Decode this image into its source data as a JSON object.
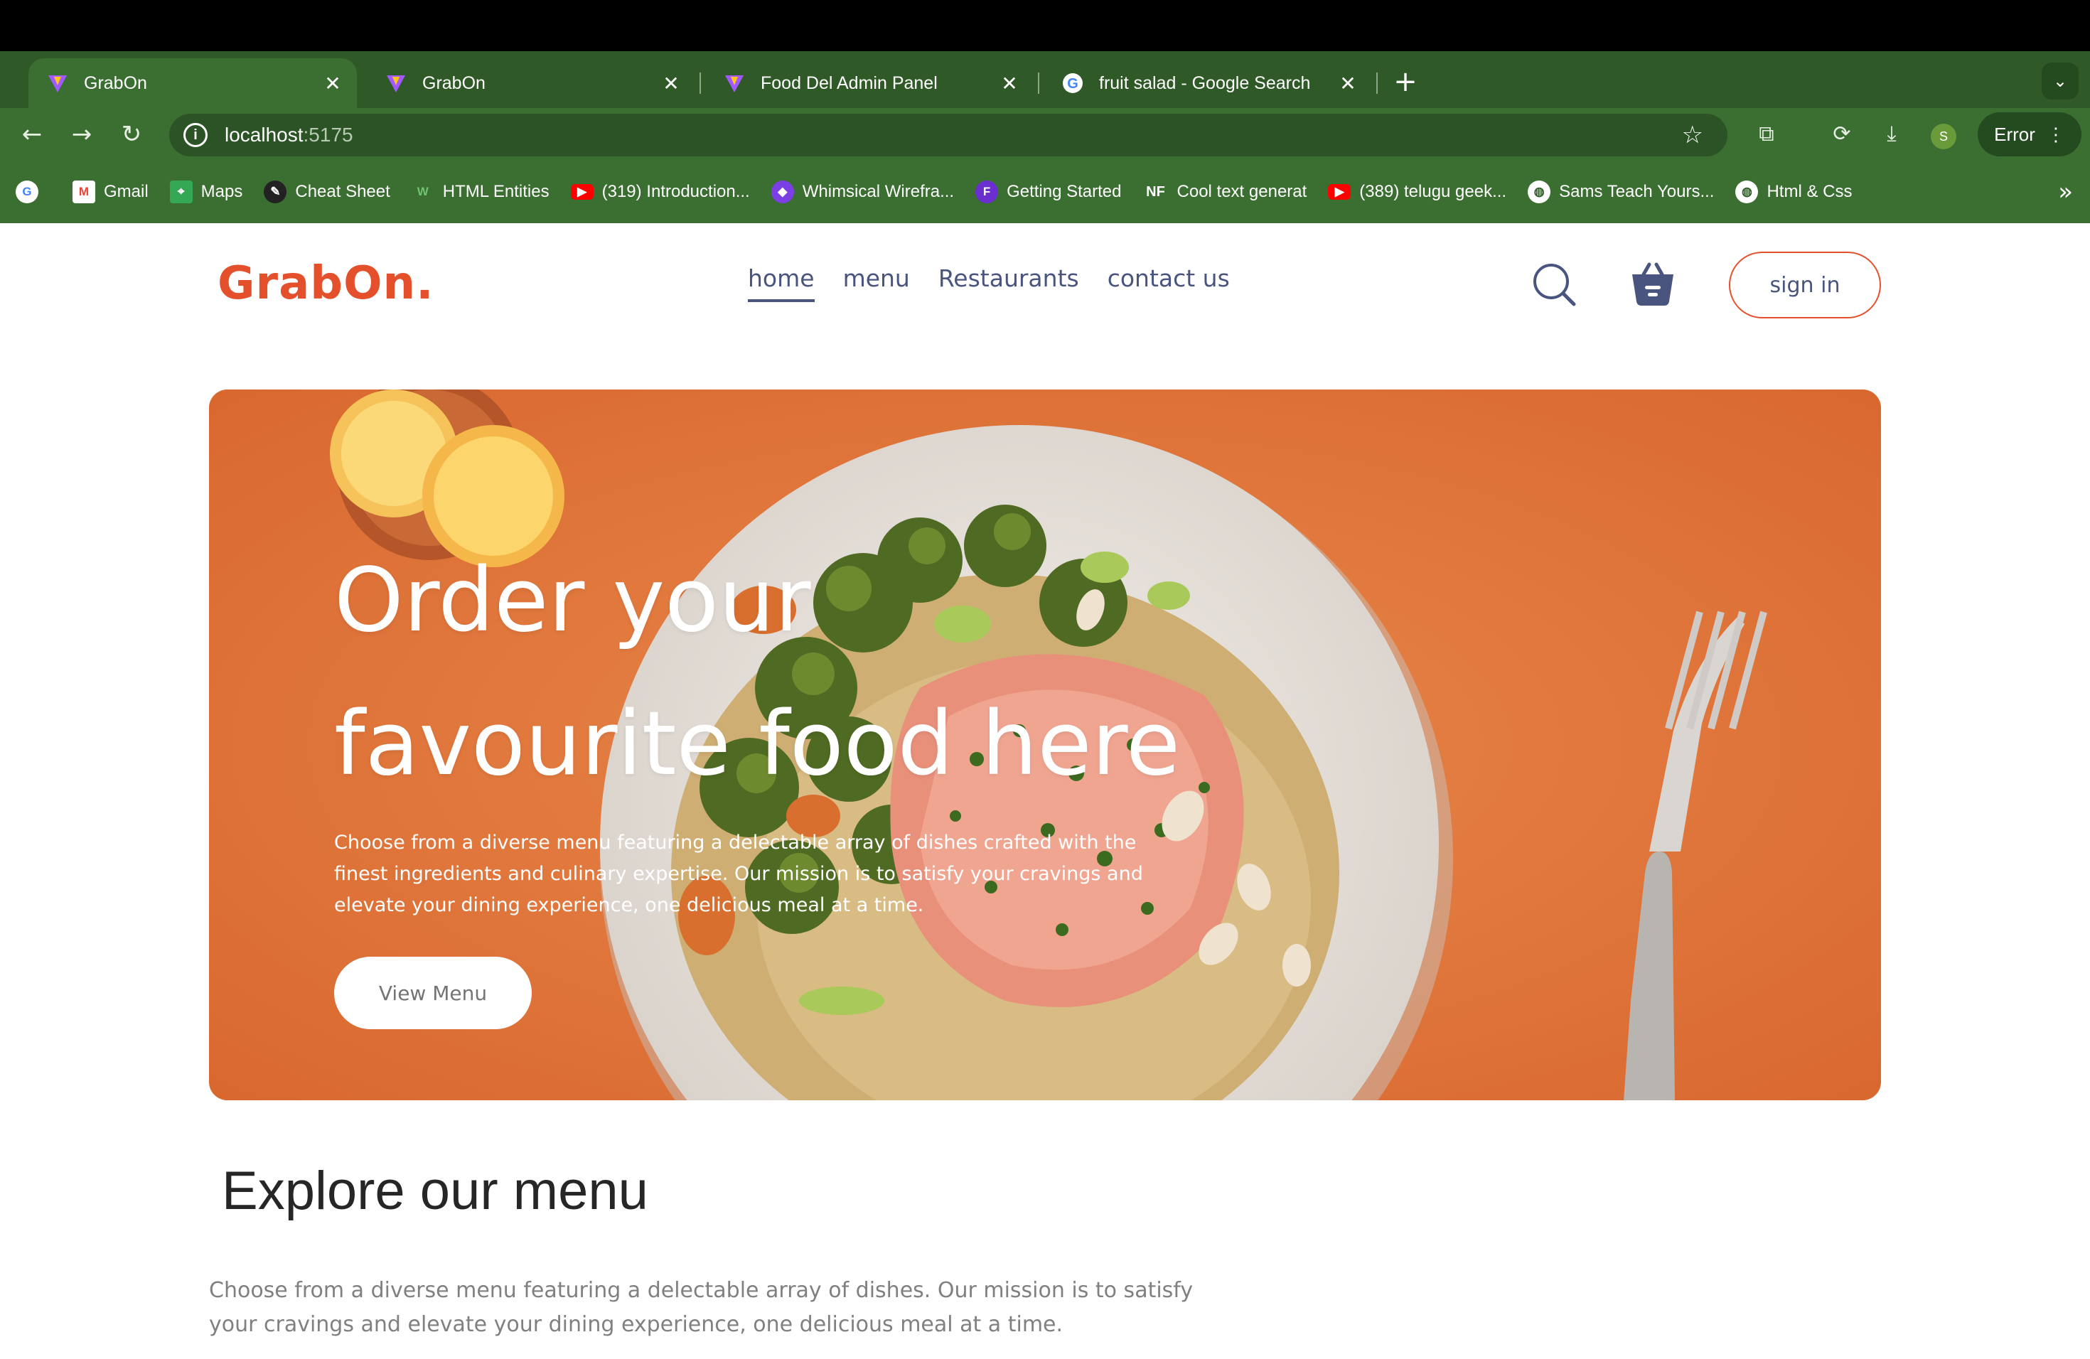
{
  "browser": {
    "tabs": [
      {
        "label": "GrabOn",
        "icon": "vite-icon",
        "active": true
      },
      {
        "label": "GrabOn",
        "icon": "vite-icon",
        "active": false
      },
      {
        "label": "Food Del Admin Panel",
        "icon": "vite-icon",
        "active": false
      },
      {
        "label": "fruit salad - Google Search",
        "icon": "google-icon",
        "active": false
      }
    ],
    "url_host": "localhost",
    "url_port": ":5175",
    "profile_initial": "S",
    "error_label": "Error",
    "bookmarks": [
      {
        "label": "Gmail",
        "icon": "gmail-icon",
        "color": "#ea4335"
      },
      {
        "label": "Maps",
        "icon": "maps-icon",
        "color": "#34a853"
      },
      {
        "label": "Cheat Sheet",
        "icon": "cheatsheet-icon",
        "color": "#222222"
      },
      {
        "label": "HTML Entities",
        "icon": "w-icon",
        "color": "#3c8c3c"
      },
      {
        "label": "(319) Introduction...",
        "icon": "youtube-icon",
        "color": "#ff0000"
      },
      {
        "label": "Whimsical Wirefra...",
        "icon": "whimsical-icon",
        "color": "#7b3fe4"
      },
      {
        "label": "Getting Started",
        "icon": "f-icon",
        "color": "#6b2fd0"
      },
      {
        "label": "Cool text generat",
        "icon": "nf-icon",
        "color": "#2e4b8f"
      },
      {
        "label": "(389) telugu geek...",
        "icon": "youtube-icon",
        "color": "#ff0000"
      },
      {
        "label": "Sams Teach Yours...",
        "icon": "globe-icon",
        "color": "#ffffff"
      },
      {
        "label": "Html & Css",
        "icon": "globe-icon",
        "color": "#ffffff"
      }
    ]
  },
  "site": {
    "logo": "GrabOn.",
    "nav": [
      "home",
      "menu",
      "Restaurants",
      "contact us"
    ],
    "active_nav": "home",
    "signin_label": "sign in",
    "colors": {
      "brand": "#e5502c",
      "nav": "#49557e",
      "hero": "#e17a3f"
    }
  },
  "hero": {
    "title_line1": "Order your",
    "title_line2": "favourite food here",
    "subtitle": "Choose from a diverse menu featuring a delectable array of dishes crafted with the finest ingredients and culinary expertise. Our mission is to satisfy your cravings and elevate your dining experience, one delicious meal at a time.",
    "button": "View Menu"
  },
  "explore": {
    "title": "Explore our menu",
    "text": "Choose from a diverse menu featuring a delectable array of dishes. Our mission is to satisfy your cravings and elevate your dining experience, one delicious meal at a time."
  }
}
